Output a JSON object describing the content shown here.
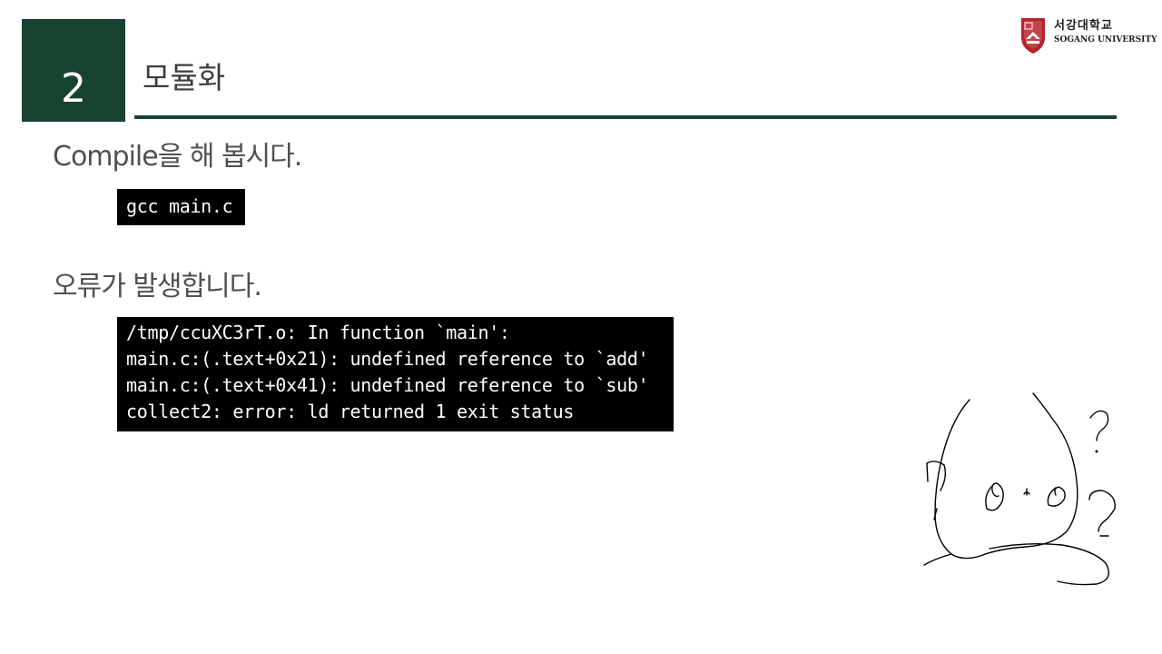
{
  "header": {
    "section_number": "2",
    "title": "모듈화",
    "accent_color": "#17422f"
  },
  "logo": {
    "kr_name": "서강대학교",
    "en_name": "SOGANG UNIVERSITY",
    "crest_color": "#b5242b"
  },
  "content": {
    "heading1": "Compile을 해 봅시다.",
    "command": "gcc main.c",
    "heading2": "오류가 발생합니다.",
    "error_lines": [
      "/tmp/ccuXC3rT.o: In function `main':",
      "main.c:(.text+0x21): undefined reference to `add'",
      "main.c:(.text+0x41): undefined reference to `sub'",
      "collect2: error: ld returned 1 exit status"
    ]
  },
  "doodle": {
    "marks": [
      "?",
      "?",
      "?"
    ]
  }
}
